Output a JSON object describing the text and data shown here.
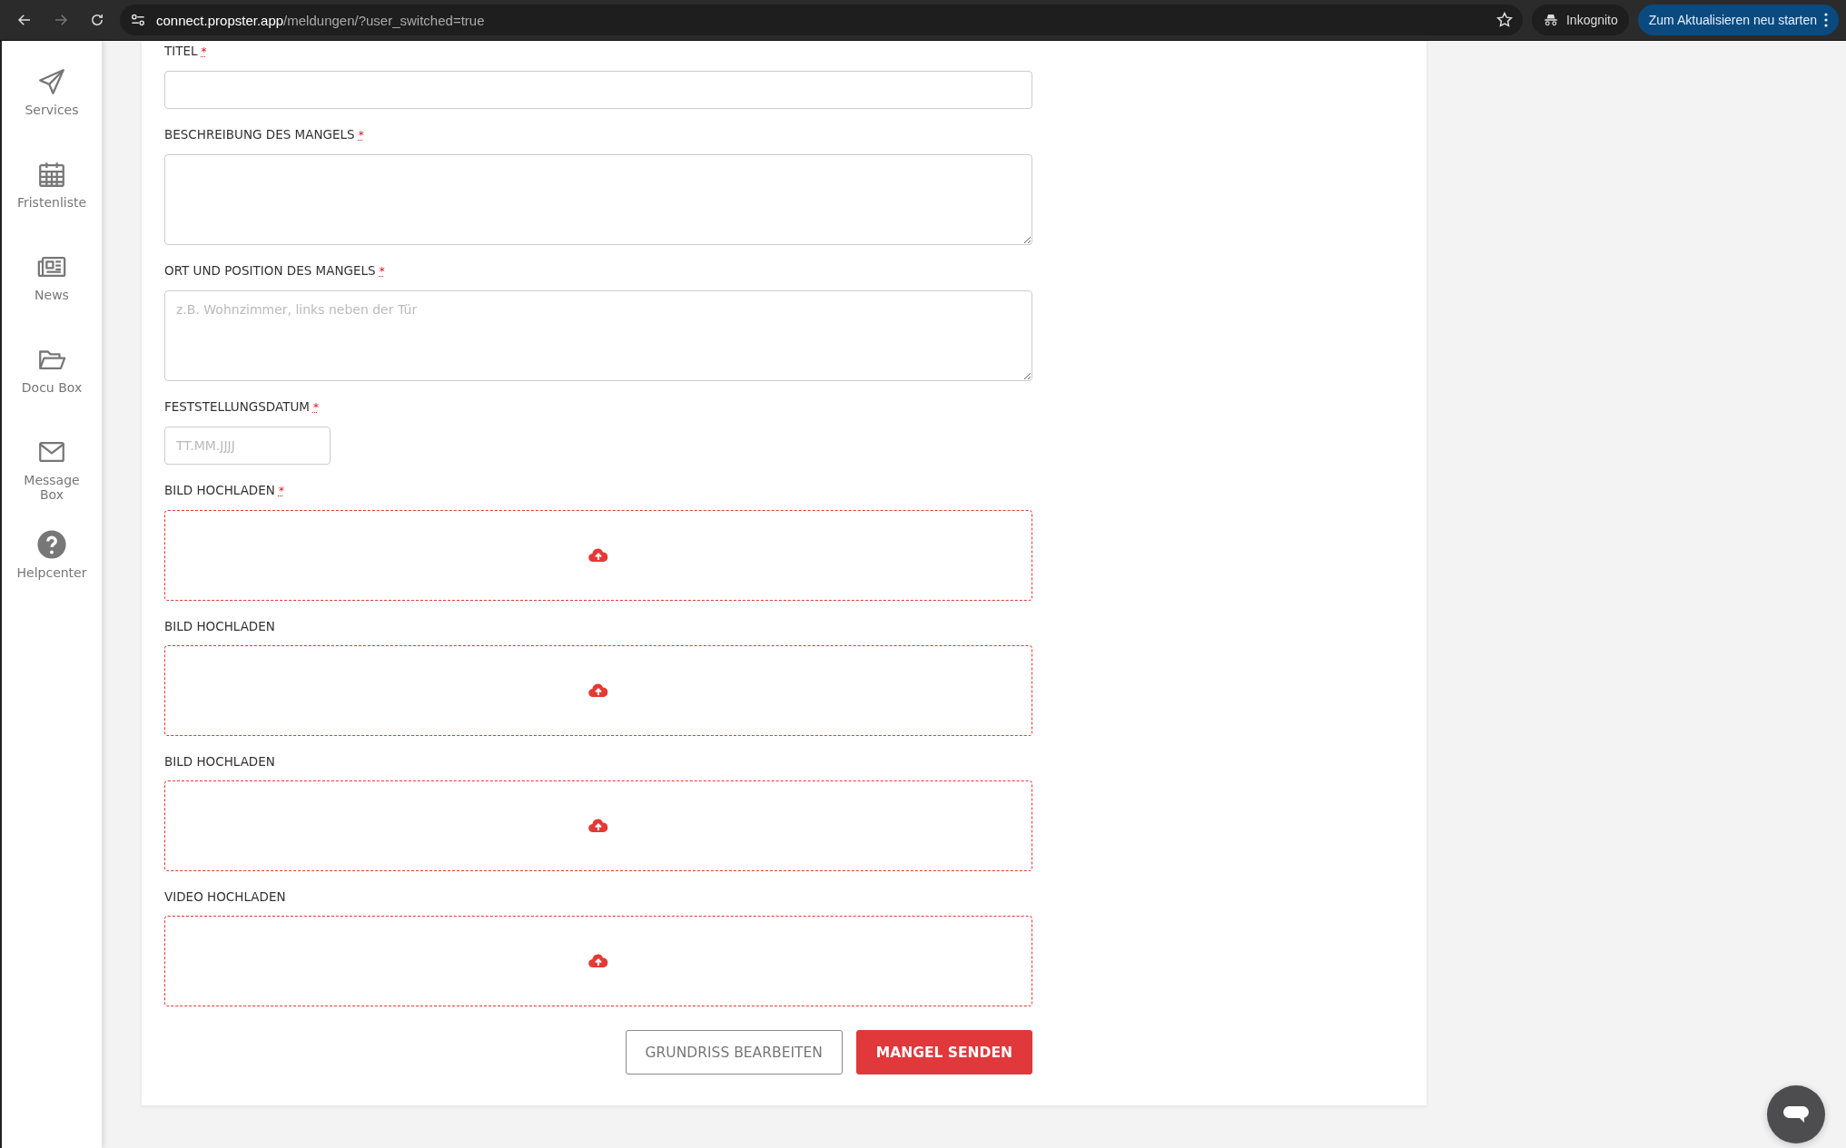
{
  "browser": {
    "url_host": "connect.propster.app",
    "url_path": "/meldungen/?user_switched=true",
    "forward_disabled": true,
    "incognito_label": "Inkognito",
    "update_button": "Zum Aktualisieren neu starten"
  },
  "sidebar": {
    "items": [
      {
        "label": "Services"
      },
      {
        "label": "Fristenliste"
      },
      {
        "label": "News"
      },
      {
        "label": "Docu Box"
      },
      {
        "label": "Message Box"
      },
      {
        "label": "Helpcenter"
      }
    ]
  },
  "required_marker": "*",
  "form": {
    "fields": [
      {
        "kind": "text",
        "label": "TITEL",
        "required": true
      },
      {
        "kind": "textarea",
        "label": "BESCHREIBUNG DES MANGELS",
        "required": true
      },
      {
        "kind": "textarea",
        "label": "ORT UND POSITION DES MANGELS",
        "required": true,
        "placeholder": "z.B. Wohnzimmer, links neben der Tür"
      },
      {
        "kind": "date",
        "label": "FESTSTELLUNGSDATUM",
        "required": true,
        "placeholder": "TT.MM.JJJJ"
      },
      {
        "kind": "upload",
        "label": "BILD HOCHLADEN",
        "required": true
      },
      {
        "kind": "upload",
        "label": "BILD HOCHLADEN",
        "required": false
      },
      {
        "kind": "upload",
        "label": "BILD HOCHLADEN",
        "required": false
      },
      {
        "kind": "upload",
        "label": "VIDEO HOCHLADEN",
        "required": false
      }
    ],
    "buttons": [
      {
        "kind": "secondary",
        "label": "GRUNDRISS BEARBEITEN"
      },
      {
        "kind": "primary",
        "label": "MANGEL SENDEN"
      }
    ]
  }
}
